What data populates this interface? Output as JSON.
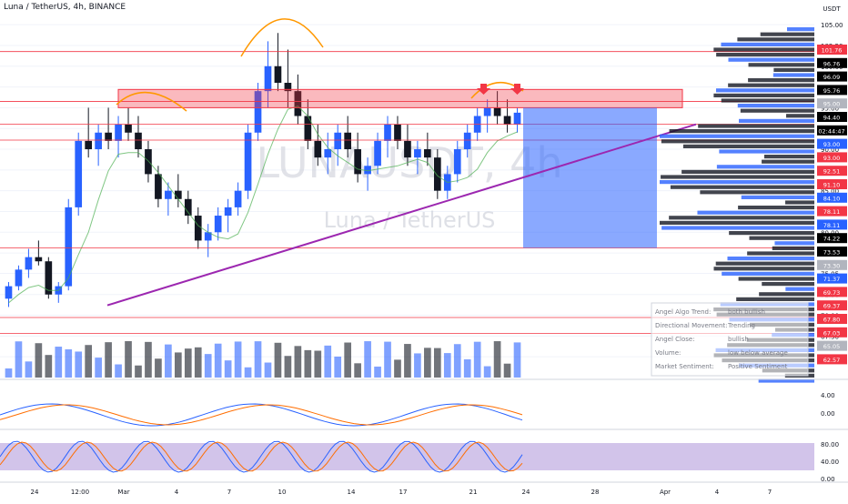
{
  "header": {
    "title": "Luna / TetherUS, 4h, BINANCE"
  },
  "watermark": {
    "symbol": "LUNAUSDT, 4h",
    "name": "Luna / TetherUS"
  },
  "price_axis": {
    "currency": "USDT",
    "ticks": [
      "105.00",
      "102.50",
      "100.00",
      "97.50",
      "95.00",
      "92.50",
      "90.00",
      "87.50",
      "85.00",
      "82.50",
      "80.00",
      "77.50",
      "75.05",
      "72.50",
      "70.00",
      "67.50",
      "65.00"
    ],
    "badges": [
      {
        "text": "101.76",
        "color": "#f23645"
      },
      {
        "text": "96.76",
        "color": "#000000"
      },
      {
        "text": "96.09",
        "color": "#000000"
      },
      {
        "text": "95.76",
        "color": "#000000"
      },
      {
        "text": "95.00",
        "color": "#b2b5be"
      },
      {
        "text": "94.40",
        "color": "#000000"
      },
      {
        "text": "02:44:47",
        "color": "#000000"
      },
      {
        "text": "93.00",
        "color": "#2962ff"
      },
      {
        "text": "93.00",
        "color": "#f23645"
      },
      {
        "text": "92.51",
        "color": "#f23645"
      },
      {
        "text": "91.10",
        "color": "#f23645"
      },
      {
        "text": "84.10",
        "color": "#2962ff"
      },
      {
        "text": "78.11",
        "color": "#f23645"
      },
      {
        "text": "78.11",
        "color": "#2962ff"
      },
      {
        "text": "74.22",
        "color": "#000000"
      },
      {
        "text": "73.53",
        "color": "#000000"
      },
      {
        "text": "73.30",
        "color": "#b2b5be"
      },
      {
        "text": "71.37",
        "color": "#2962ff"
      },
      {
        "text": "69.73",
        "color": "#f23645"
      },
      {
        "text": "69.37",
        "color": "#f23645"
      },
      {
        "text": "67.80",
        "color": "#f23645"
      },
      {
        "text": "67.03",
        "color": "#f23645"
      },
      {
        "text": "65.05",
        "color": "#b2b5be"
      },
      {
        "text": "62.57",
        "color": "#f23645"
      }
    ]
  },
  "time_axis": {
    "labels": [
      "24",
      "12:00",
      "Mar",
      "4",
      "7",
      "10",
      "14",
      "17",
      "21",
      "24",
      "28",
      "Apr",
      "4",
      "7"
    ]
  },
  "oscillators": {
    "macd_ticks": [
      "4.00",
      "0.00"
    ],
    "stoch_ticks": [
      "80.00",
      "40.00",
      "0.00"
    ]
  },
  "info_table": {
    "rows": [
      {
        "label": "Angel Algo Trend:",
        "value": "both bullish"
      },
      {
        "label": "Directional Movement:",
        "value": "Trending"
      },
      {
        "label": "Angel Close:",
        "value": "bullish"
      },
      {
        "label": "Volume:",
        "value": "low below average"
      },
      {
        "label": "Market Sentiment:",
        "value": "Positive Sentiment"
      }
    ]
  },
  "colors": {
    "up": "#2962ff",
    "down": "#131722",
    "resistance": "#f23645",
    "trendline": "#9c27b0",
    "annotation": "#ff9800"
  },
  "chart_data": {
    "type": "candlestick",
    "title": "Luna / TetherUS, 4h, BINANCE",
    "ylim": [
      62.5,
      106
    ],
    "key_levels": [
      101.76,
      95.76,
      93.0,
      91.1,
      78.11,
      69.73,
      67.8
    ],
    "series": [
      {
        "name": "price",
        "values": [
          [
            72,
            74,
            71,
            73.5
          ],
          [
            73.5,
            76,
            73,
            75.5
          ],
          [
            75.5,
            78,
            74.5,
            77
          ],
          [
            77,
            79,
            76,
            76.5
          ],
          [
            76.5,
            77,
            72,
            72.5
          ],
          [
            72.5,
            74,
            71.5,
            73.5
          ],
          [
            73.5,
            84,
            73,
            83
          ],
          [
            83,
            92,
            82,
            91
          ],
          [
            91,
            95,
            89,
            90
          ],
          [
            90,
            93,
            88,
            92
          ],
          [
            92,
            95,
            90,
            91
          ],
          [
            91,
            94,
            89,
            93
          ],
          [
            93,
            95,
            91,
            92
          ],
          [
            92,
            94,
            89,
            90
          ],
          [
            90,
            91,
            86,
            87
          ],
          [
            87,
            88,
            83,
            84
          ],
          [
            84,
            86,
            82,
            85
          ],
          [
            85,
            87,
            83,
            84
          ],
          [
            84,
            85,
            81,
            82
          ],
          [
            82,
            83,
            78,
            79
          ],
          [
            79,
            81,
            77,
            80
          ],
          [
            80,
            83,
            79,
            82
          ],
          [
            82,
            84,
            80,
            83
          ],
          [
            83,
            86,
            82,
            85
          ],
          [
            85,
            93,
            84,
            92
          ],
          [
            92,
            98,
            91,
            97
          ],
          [
            97,
            103,
            95,
            100
          ],
          [
            100,
            104,
            97,
            98
          ],
          [
            98,
            102,
            95,
            97
          ],
          [
            97,
            99,
            93,
            94
          ],
          [
            94,
            96,
            90,
            91
          ],
          [
            91,
            93,
            88,
            89
          ],
          [
            89,
            92,
            87,
            90
          ],
          [
            90,
            93,
            88,
            92
          ],
          [
            92,
            94,
            89,
            90
          ],
          [
            90,
            92,
            86,
            87
          ],
          [
            87,
            89,
            85,
            88
          ],
          [
            88,
            92,
            87,
            91
          ],
          [
            91,
            94,
            89,
            93
          ],
          [
            93,
            94,
            90,
            91
          ],
          [
            91,
            93,
            88,
            89
          ],
          [
            89,
            91,
            87,
            90
          ],
          [
            90,
            92,
            88,
            89
          ],
          [
            89,
            90,
            84,
            85
          ],
          [
            85,
            88,
            84,
            87
          ],
          [
            87,
            91,
            86,
            90
          ],
          [
            90,
            93,
            89,
            92
          ],
          [
            92,
            95,
            91,
            94
          ],
          [
            94,
            96,
            92,
            95
          ],
          [
            95,
            97,
            93,
            94
          ],
          [
            94,
            96,
            92,
            93
          ],
          [
            93,
            95,
            92,
            94.4
          ]
        ]
      }
    ],
    "volume_max": 100
  }
}
